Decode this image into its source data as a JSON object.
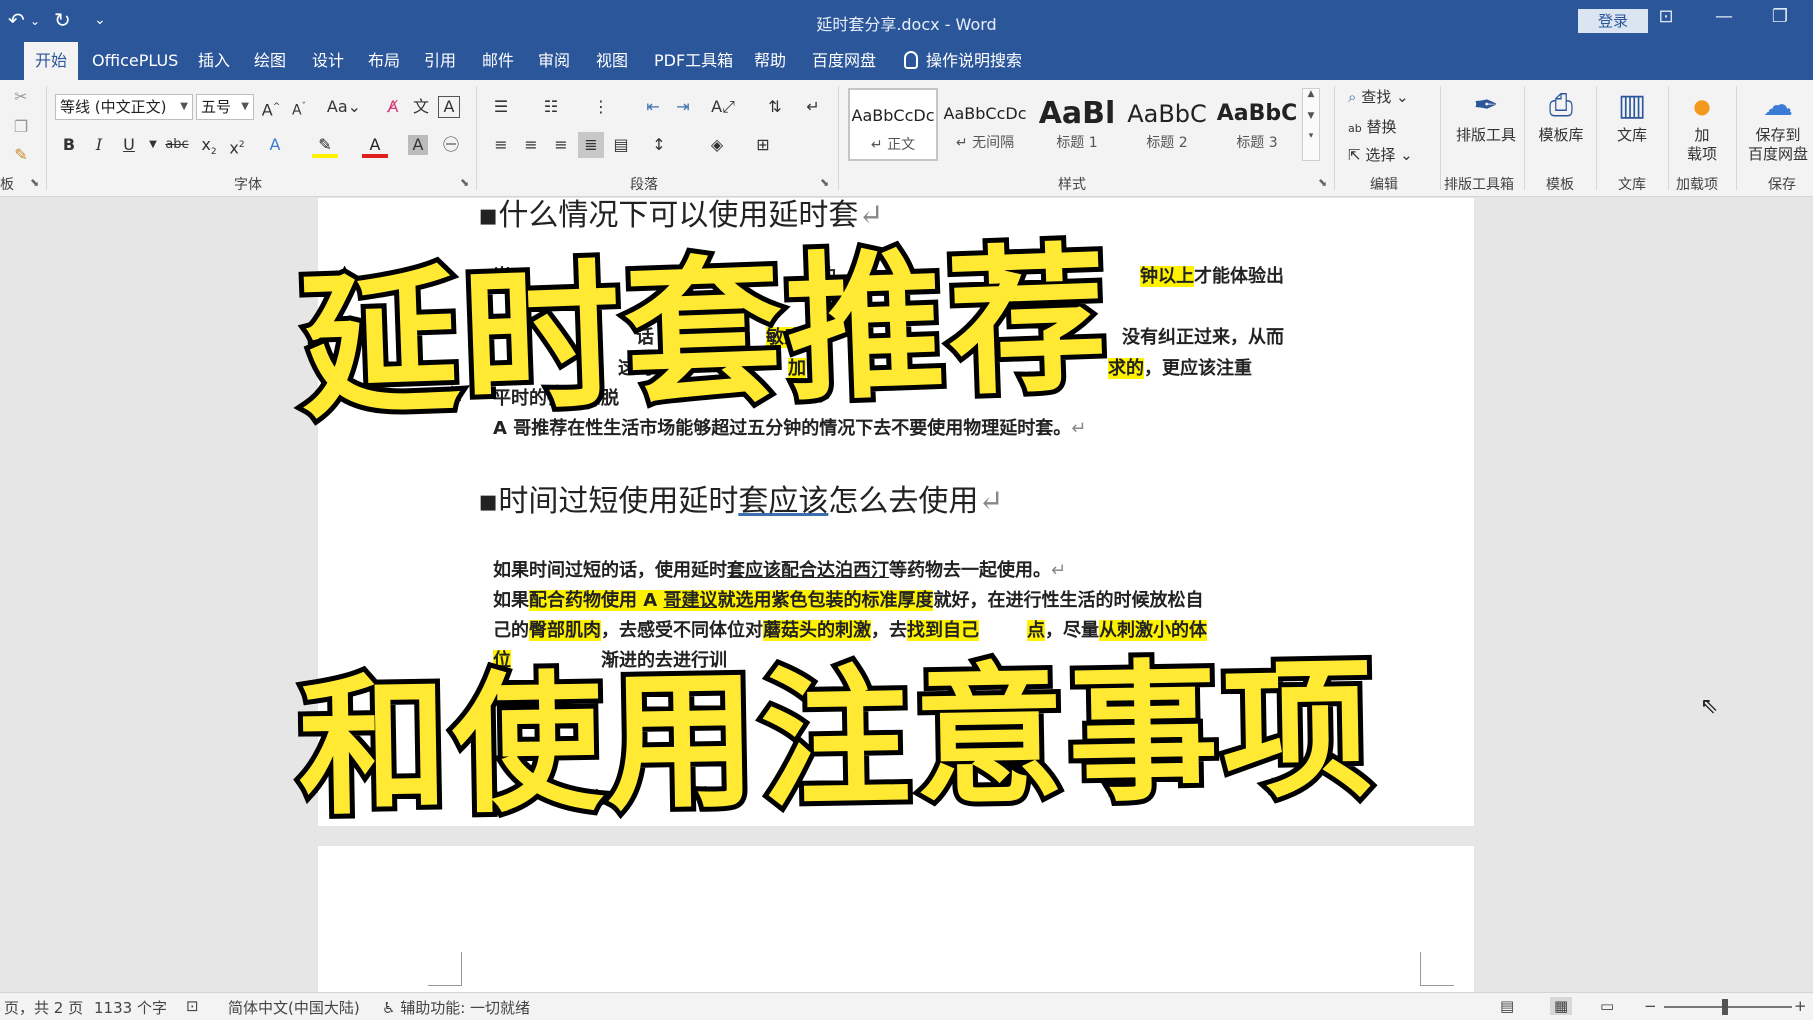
{
  "window": {
    "title": "延时套分享.docx - Word",
    "login_label": "登录",
    "qa_undo": "↶",
    "qa_redo": "↻",
    "qa_more": "⌄",
    "min": "—",
    "restore": "❐",
    "ribbon_display": "⊡"
  },
  "ribbon_tabs": [
    "开始",
    "OfficePLUS",
    "插入",
    "绘图",
    "设计",
    "布局",
    "引用",
    "邮件",
    "审阅",
    "视图",
    "PDF工具箱",
    "帮助",
    "百度网盘",
    "操作说明搜索"
  ],
  "font_group": {
    "font_name": "等线 (中文正文)",
    "font_size": "五号",
    "label": "字体"
  },
  "paragraph_group": {
    "label": "段落"
  },
  "styles_group": {
    "label": "样式",
    "items": [
      {
        "preview": "AaBbCcDc",
        "name": "↵ 正文"
      },
      {
        "preview": "AaBbCcDc",
        "name": "↵ 无间隔"
      },
      {
        "preview": "AaBl",
        "name": "标题 1"
      },
      {
        "preview": "AaBbC",
        "name": "标题 2"
      },
      {
        "preview": "AaBbC",
        "name": "标题 3"
      }
    ]
  },
  "editing_group": {
    "label": "编辑",
    "find": "查找",
    "replace": "替换",
    "select": "选择"
  },
  "tool_buttons": [
    {
      "label": "排版工具",
      "group": "排版工具箱"
    },
    {
      "label": "模板库",
      "group": "模板"
    },
    {
      "label": "文库",
      "group": "文库"
    },
    {
      "label": "加\n载项",
      "group": "加载项"
    },
    {
      "label": "保存到\n百度网盘",
      "group": "保存"
    }
  ],
  "clipboard_label": "板",
  "document": {
    "heading1": "什么情况下可以使用延时套",
    "line1_a": "当",
    "line1_b": "在",
    "line1_c": "的",
    "line1_hl": "钟以上",
    "line1_d": "才能体验出",
    "line2_a": "话",
    "line2_b": "敏感",
    "line2_end": "没有纠正过来，从而",
    "line3_a": "这时",
    "line3_hl": "加",
    "line3_b": "求的",
    "line3_end": "，更应该注重",
    "line4": "平时的锻炼和脱",
    "line5": "A 哥推荐在性生活市场能够超过五分钟的情况下去不要使用物理延时套。",
    "heading2_a": "时间过短使用延时",
    "heading2_b": "套应该",
    "heading2_c": "怎么去使用",
    "p1_a": "如果时间过短的话，使用延时",
    "p1_b": "套应该配合达泊西汀",
    "p1_c": "等药物去一起使用。",
    "p2_a": "如果",
    "p2_hl1": "配合药物使用 A ",
    "p2_hl2": "哥建议",
    "p2_hl3": "就选用紫色包装的标准厚度",
    "p2_b": "就好，在进行性生活的时候放松自",
    "p3_a": "己的",
    "p3_hl1": "臀部肌肉",
    "p3_b": "，去感受不同体位对",
    "p3_hl2": "蘑菇头的刺激",
    "p3_c": "，去",
    "p3_hl3": "找到自己",
    "p3_hl4": "点",
    "p3_d": "，尽量",
    "p3_hl5": "从刺激小的体",
    "p4_hl": "位",
    "p4_a": "渐进的去进行训",
    "para_mark": "↵"
  },
  "overlay": {
    "top": "延时套推荐",
    "bottom": "和使用注意事项"
  },
  "status": {
    "page": "页，共 2 页",
    "words": "1133 个字",
    "language": "简体中文(中国大陆)",
    "accessibility": "辅助功能: 一切就绪"
  },
  "colors": {
    "title_bar": "#2b579a",
    "highlight": "#fff200",
    "overlay_fill": "#ffe933",
    "overlay_stroke": "#000000"
  }
}
